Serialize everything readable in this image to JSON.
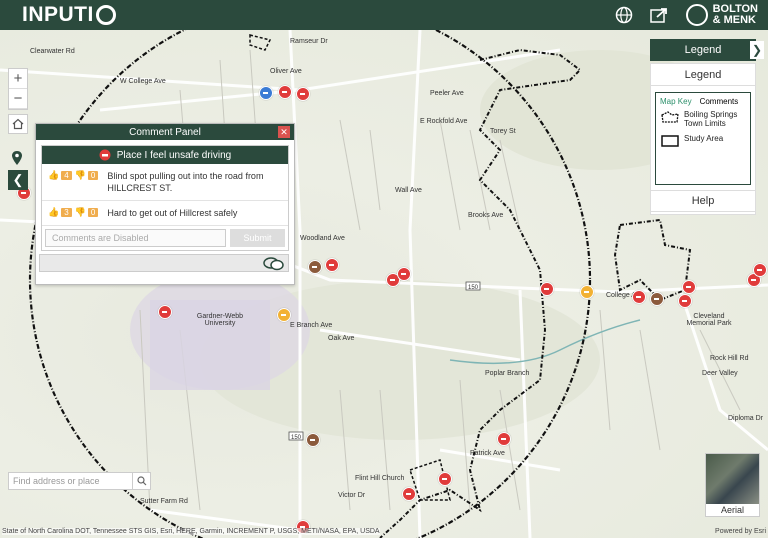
{
  "header": {
    "logo_text": "INPUTI",
    "brand_line1": "BOLTON",
    "brand_line2": "& MENK",
    "icons": [
      "globe-icon",
      "share-icon"
    ]
  },
  "map": {
    "zoom_in": "+",
    "zoom_out": "−",
    "road_labels": [
      "Clearwater Rd",
      "W College Ave",
      "Oliver Ave",
      "Peeler Ave",
      "Ramseur Dr",
      "E Rockfold Ave",
      "Wall Ave",
      "Brooks Ave",
      "Woodland Ave",
      "E Branch Ave",
      "Oak Ave",
      "College Ave",
      "Poplar Branch",
      "Patrick Ave",
      "Flint Hill Church",
      "Victor Dr",
      "Sutter Farm Rd",
      "Gardner-Webb University",
      "Cleveland Memorial Park",
      "Rock Hill Rd",
      "Diploma Dr",
      "Deer Valley",
      "Torey St"
    ],
    "route_shields": [
      "150",
      "150"
    ]
  },
  "comment_panel": {
    "title": "Comment Panel",
    "close": "✕",
    "topic": "Place I feel unsafe driving",
    "comments": [
      {
        "up": "4",
        "down": "0",
        "text": "Blind spot pulling out into the road from HILLCREST ST."
      },
      {
        "up": "3",
        "down": "0",
        "text": "Hard to get out of Hillcrest safely"
      }
    ],
    "input_placeholder": "Comments are Disabled",
    "submit_label": "Submit"
  },
  "legend": {
    "title": "Legend",
    "subtitle": "Legend",
    "tabs": [
      "Map Key",
      "Comments"
    ],
    "items": [
      {
        "label": "Boiling Springs Town Limits"
      },
      {
        "label": "Study Area"
      }
    ],
    "help": "Help"
  },
  "search": {
    "placeholder": "Find address or place"
  },
  "aerial": {
    "label": "Aerial"
  },
  "attribution": "State of North Carolina DOT, Tennessee STS GIS, Esri, HERE, Garmin, INCREMENT P, USGS, METI/NASA, EPA, USDA",
  "powered_by": "Powered by Esri",
  "colors": {
    "header": "#2b4a3d",
    "marker_unsafe": "#e03b3b",
    "marker_walk": "#8b5a3c",
    "marker_comment": "#f2b134",
    "vote": "#f0ad4e"
  }
}
